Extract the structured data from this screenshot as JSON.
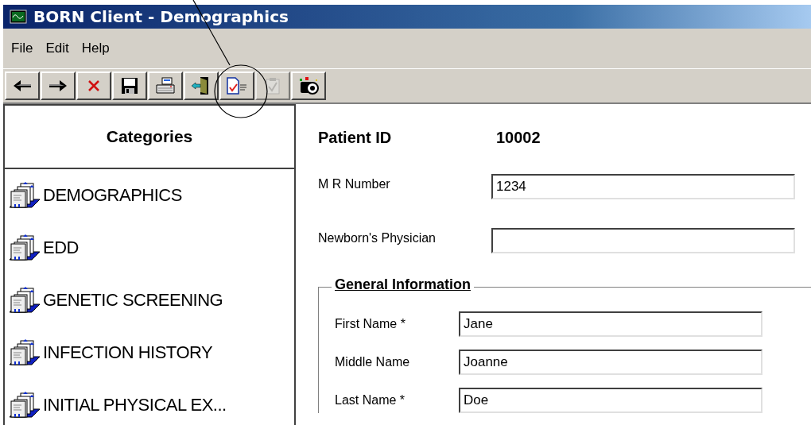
{
  "window": {
    "title": "BORN Client - Demographics"
  },
  "menu": [
    "File",
    "Edit",
    "Help"
  ],
  "toolbar": [
    {
      "kind": "back",
      "disabled": false
    },
    {
      "kind": "forward",
      "disabled": false
    },
    {
      "kind": "delete",
      "disabled": false
    },
    {
      "kind": "save",
      "disabled": false
    },
    {
      "kind": "print",
      "disabled": false
    },
    {
      "kind": "exit",
      "disabled": false
    },
    {
      "kind": "report",
      "disabled": false
    },
    {
      "kind": "check",
      "disabled": true
    },
    {
      "kind": "camera",
      "disabled": false
    }
  ],
  "sidebar": {
    "title": "Categories",
    "items": [
      "DEMOGRAPHICS",
      "EDD",
      "GENETIC SCREENING",
      "INFECTION HISTORY",
      "INITIAL PHYSICAL EX..."
    ]
  },
  "patient": {
    "label": "Patient ID",
    "value": "10002"
  },
  "fields": [
    {
      "label": "M R Number",
      "value": "1234"
    },
    {
      "label": "Newborn's Physician"
    }
  ],
  "general": {
    "title": "General Information",
    "fields": [
      {
        "label": "First Name *",
        "value": "Jane"
      },
      {
        "label": "Middle Name",
        "value": "Joanne"
      },
      {
        "label": "Last Name *",
        "value": "Doe"
      }
    ]
  }
}
